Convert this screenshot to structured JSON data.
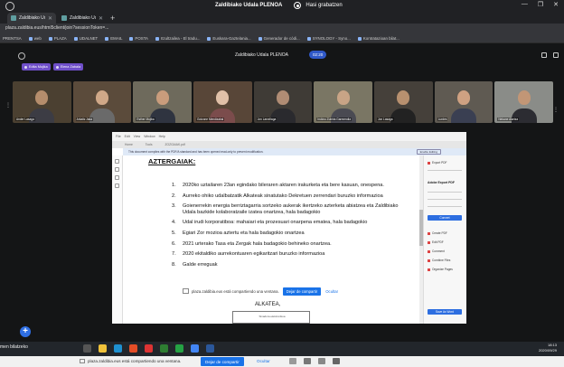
{
  "browser": {
    "tabs": [
      {
        "label": "Zaldibiako Uda..."
      },
      {
        "label": "Zaldibiako Uda..."
      }
    ],
    "new_tab": "+",
    "url": "plaza.zaldibia.eus/html5client/join?sessionToken=...",
    "bookmarks": [
      "PRENTSA",
      "web",
      "PLAZA",
      "UDALNET",
      "EMAIL",
      "POSTA",
      "Itzultzailea - El tradu...",
      "Euskara-Gaztelania...",
      "Generador de códi...",
      "SYNOLOGY - Syno...",
      "Kontratazioan bilat..."
    ],
    "share_title": "Zaldibiako Udala PLENOA",
    "share_rec": "Hasi grabatzen",
    "win_controls": [
      "—",
      "❐",
      "✕"
    ]
  },
  "meeting": {
    "title": "Zaldibiako Udala PLENOA",
    "timer": "02:20",
    "chips": [
      "Edita Mujika",
      "Elena Zabala"
    ],
    "participants": [
      {
        "name": "Ander Lasaga"
      },
      {
        "name": "Arkaitz Jaka"
      },
      {
        "name": "Esther Mujika"
      },
      {
        "name": "Gotzone Mendizabal"
      },
      {
        "name": "Jon Larrañaga"
      },
      {
        "name": "Irukixu Zubiria Garmendia"
      },
      {
        "name": "Jon Lasaga"
      },
      {
        "name": "Lurdes"
      },
      {
        "name": "Nekane Aiartza"
      }
    ]
  },
  "pdf": {
    "ie_menu": [
      "File",
      "Edit",
      "View",
      "Window",
      "Help"
    ],
    "ie_tabs": [
      "Home",
      "Tools",
      "ZOZGAIAK.pdf"
    ],
    "notice": "This document complies with the PDF/A standard and has been opened read-only to prevent modification.",
    "notice_button": "Enable Editing",
    "agenda_title": "AZTERGAIAK:",
    "agenda": [
      {
        "num": "1.",
        "text": "2020ko uztailaren 23an egindako bileraren aktaren irakurketa eta bere kasuan, onespena."
      },
      {
        "num": "2.",
        "text": "Aurreko ohiko udalbatzatik Alkateak sinatutako Dekretuen zerrendari buruzko informazioa"
      },
      {
        "num": "3.",
        "text": "Goienerrekin energia berriztagarria sortzeko aukerak ikertzeko azterketa abiatzea eta Zaldibiako Udala bazkide kolaboratzaile izatea onartzea, hala badagokio"
      },
      {
        "num": "4.",
        "text": "Udal irudi korporatiboa: mahaiari eta prozesuari onarpena ematea, hala badagokio"
      },
      {
        "num": "5.",
        "text": "Egiari Zor mozioa aztertu eta hala badagokio onartzea"
      },
      {
        "num": "6.",
        "text": "2021 urterako Tasa eta Zergak hala badagokio behineko onartzea."
      },
      {
        "num": "7.",
        "text": "2020 ekitaldiko aurrekontuaren egikaritzari buruzko informazioa"
      },
      {
        "num": "8.",
        "text": "Galde erreguak"
      }
    ],
    "closing": "ALKATEA,",
    "signature_caption": "Sinadura elektronikoa",
    "right_panel": {
      "export_label": "Export PDF",
      "title": "Adobe Export PDF",
      "convert": "Convert",
      "items": [
        "Create PDF",
        "Edit PDF",
        "Comment",
        "Combine Files",
        "Organize Pages"
      ],
      "save": "Save As Word"
    }
  },
  "share_notice": {
    "message": "plaza.zaldibia.eus está compartiendo una ventana.",
    "stop": "Dejar de compartir",
    "hide": "Ocultar"
  },
  "taskbar": {
    "left_label": "men bilatzeko",
    "time": "18:13",
    "date": "2020/09/29"
  },
  "colors": {
    "accent": "#2f58c8",
    "chip": "#6f4fc9",
    "share_stop": "#1a73e8"
  }
}
